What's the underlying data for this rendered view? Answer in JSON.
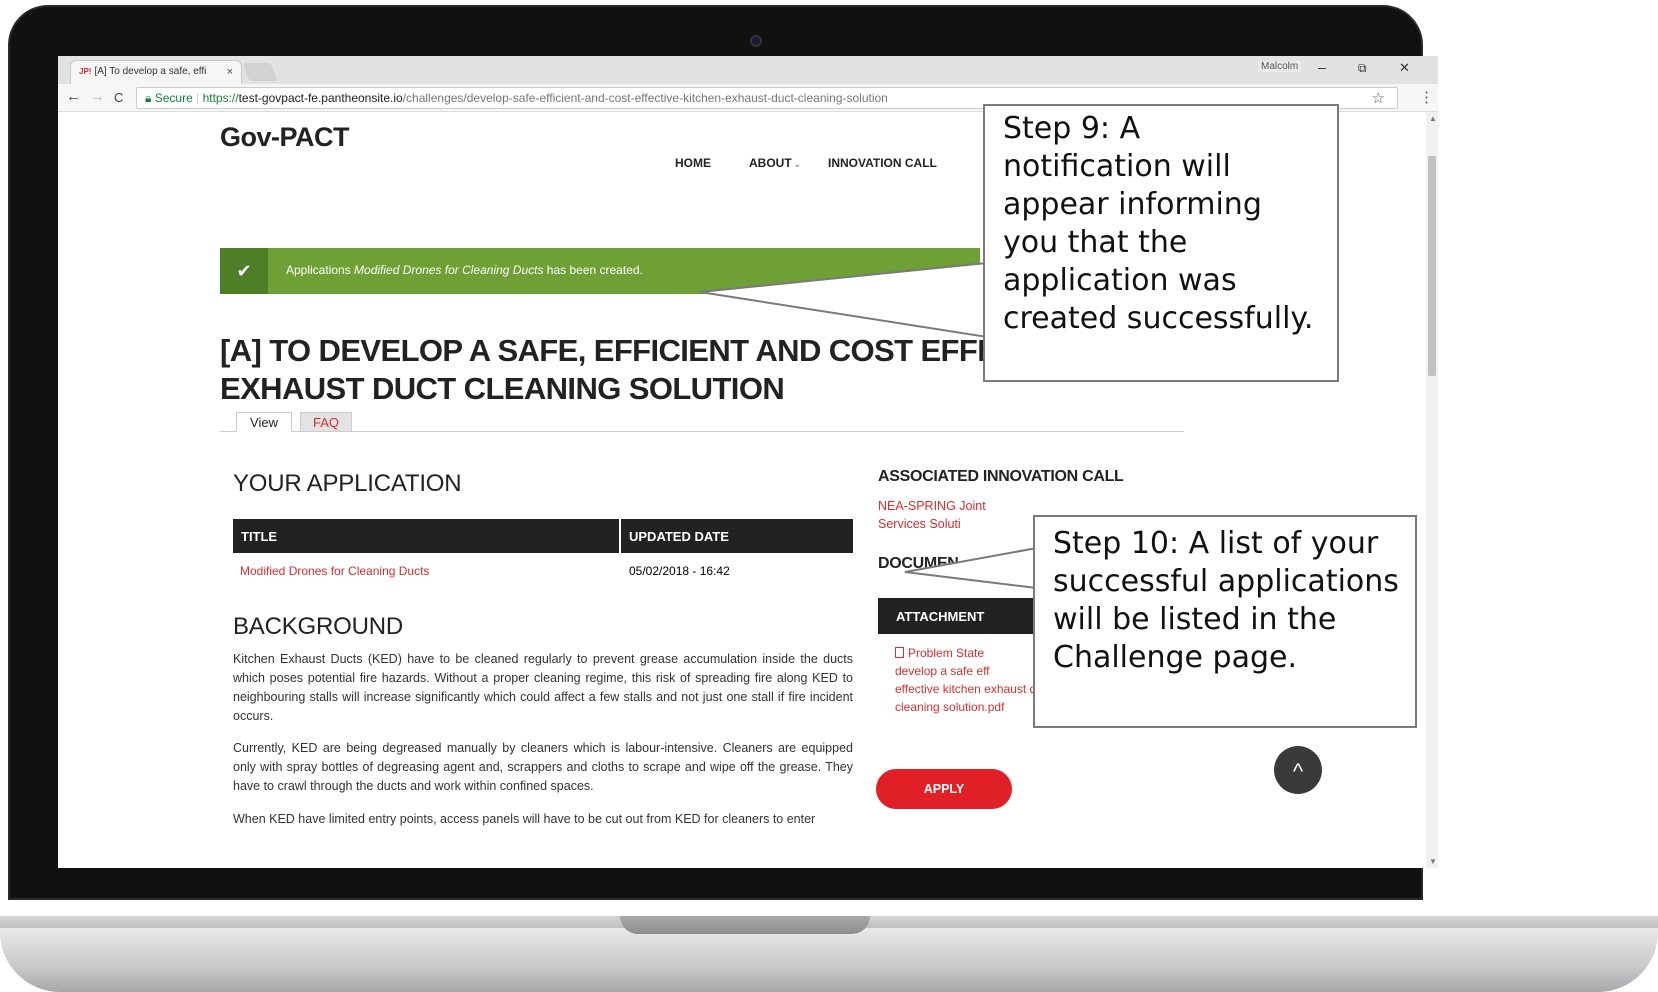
{
  "browser": {
    "tab_title": "[A] To develop a safe, effi",
    "tab_favicon": "JP!",
    "tab_close": "×",
    "user": "Malcolm",
    "win_min": "–",
    "win_restore": "⧉",
    "win_close": "✕",
    "back": "←",
    "forward": "→",
    "reload": "C",
    "secure_label": "Secure",
    "url_scheme": "https://",
    "url_host": "test-govpact-fe.pantheonsite.io",
    "url_path": "/challenges/develop-safe-efficient-and-cost-effective-kitchen-exhaust-duct-cleaning-solution",
    "star": "☆",
    "menu": "⋮"
  },
  "site": {
    "logo": "Gov-PACT",
    "nav": [
      "HOME",
      "ABOUT",
      "INNOVATION CALL"
    ]
  },
  "alert": {
    "check": "✔",
    "prefix": "Applications ",
    "application_name": "Modified Drones for Cleaning Ducts",
    "suffix": " has been created."
  },
  "challenge": {
    "title": "[A] TO DEVELOP A SAFE, EFFICIENT AND COST EFFE",
    "title_line2": "EXHAUST DUCT CLEANING SOLUTION",
    "tabs": [
      "View",
      "FAQ"
    ]
  },
  "your_application": {
    "heading": "YOUR APPLICATION",
    "columns": [
      "TITLE",
      "UPDATED DATE"
    ],
    "rows": [
      {
        "title": "Modified Drones for Cleaning Ducts",
        "updated": "05/02/2018 - 16:42"
      }
    ]
  },
  "background": {
    "heading": "BACKGROUND",
    "paragraphs": [
      "Kitchen Exhaust Ducts (KED) have to be cleaned regularly to prevent grease accumulation inside the ducts which poses potential fire hazards. Without a proper cleaning regime, this risk of spreading fire along KED to neighbouring stalls will increase significantly which could affect a few stalls and not just one stall if fire incident occurs.",
      "Currently, KED are being degreased manually by cleaners which is labour-intensive. Cleaners are equipped only with spray bottles of degreasing agent and, scrappers and cloths to scrape and wipe off the grease. They have to crawl through the ducts and work within confined spaces.",
      "When KED have limited entry points, access panels will have to be cut out from KED for cleaners to enter"
    ]
  },
  "sidebar": {
    "associated_heading": "ASSOCIATED INNOVATION CALL",
    "associated_link": "NEA-SPRING Joint",
    "associated_link_2": "Services Soluti",
    "documents_heading": "DOCUMEN",
    "attachments_heading": "ATTACHMENT",
    "attachment_lines": [
      "Problem State",
      "develop a safe eff",
      "effective kitchen exhaust duct",
      "cleaning solution.pdf"
    ],
    "apply": "APPLY",
    "back_to_top": "^"
  },
  "callouts": {
    "step9": [
      "Step 9: A",
      "notification will",
      "appear informing",
      "you that the",
      "application was",
      "created successfully."
    ],
    "step10": [
      "Step 10: A list of your",
      "successful applications",
      "will be listed in the",
      "Challenge page."
    ]
  }
}
